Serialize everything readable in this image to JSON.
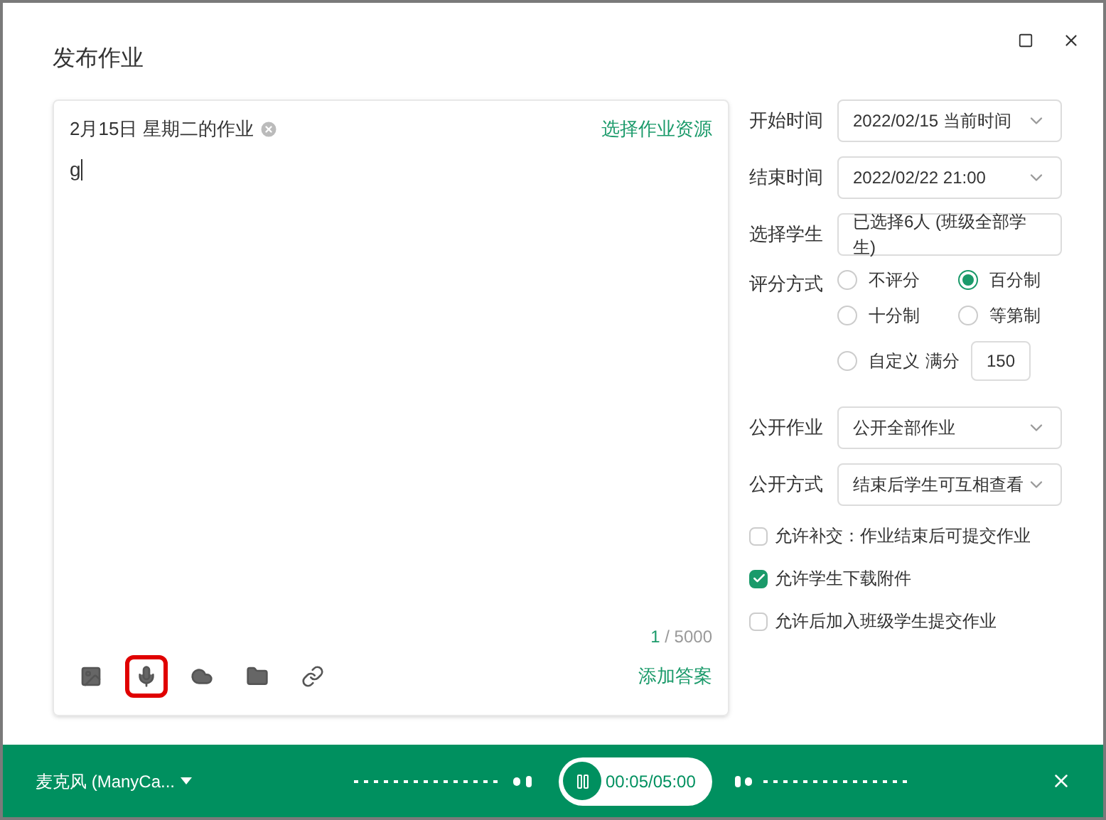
{
  "window": {
    "title": "发布作业"
  },
  "editor": {
    "title": "2月15日 星期二的作业",
    "resource_link": "选择作业资源",
    "content": "g",
    "counter_current": "1",
    "counter_total": " / 5000",
    "add_answer": "添加答案",
    "tools": [
      {
        "kind": "image",
        "highlighted": false
      },
      {
        "kind": "mic",
        "highlighted": true
      },
      {
        "kind": "cloud",
        "highlighted": false
      },
      {
        "kind": "folder",
        "highlighted": false
      },
      {
        "kind": "link",
        "highlighted": false
      }
    ]
  },
  "form": {
    "start": {
      "label": "开始时间",
      "value": "2022/02/15 当前时间"
    },
    "end": {
      "label": "结束时间",
      "value": "2022/02/22 21:00"
    },
    "students": {
      "label": "选择学生",
      "value": "已选择6人 (班级全部学生)"
    },
    "grading": {
      "label": "评分方式",
      "options": [
        {
          "kind": "plain",
          "label": "不评分",
          "selected": false
        },
        {
          "kind": "plain",
          "label": "百分制",
          "selected": true
        },
        {
          "kind": "plain",
          "label": "十分制",
          "selected": false
        },
        {
          "kind": "plain",
          "label": "等第制",
          "selected": false
        },
        {
          "kind": "custom",
          "label": "自定义",
          "full_label": "满分",
          "value": "150",
          "selected": false
        }
      ]
    },
    "publish": {
      "label": "公开作业",
      "value": "公开全部作业"
    },
    "publish_mode": {
      "label": "公开方式",
      "value": "结束后学生可互相查看"
    },
    "checks": [
      {
        "label": "允许补交：作业结束后可提交作业",
        "checked": false
      },
      {
        "label": "允许学生下载附件",
        "checked": true
      },
      {
        "label": "允许后加入班级学生提交作业",
        "checked": false
      }
    ]
  },
  "recorder": {
    "device": "麦克风 (ManyCa...",
    "time": "00:05/05:00"
  }
}
